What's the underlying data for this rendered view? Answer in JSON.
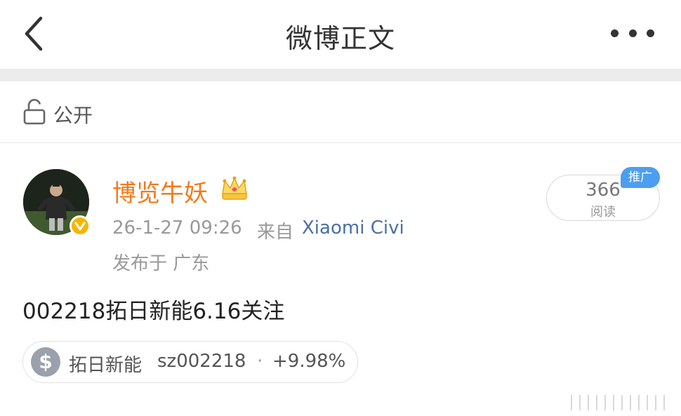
{
  "nav": {
    "title": "微博正文",
    "back_icon": "chevron-left-icon",
    "more_icon": "more-dots-icon"
  },
  "visibility": {
    "icon": "unlock-icon",
    "label": "公开"
  },
  "post": {
    "author": "博览牛妖",
    "author_color": "#f27a1d",
    "vip_icon": "crown-icon",
    "verified_icon": "verified-badge-icon",
    "time": "26-1-27 09:26",
    "source_prefix": "来自",
    "source_device": "Xiaomi Civi",
    "location": "发布于 广东",
    "views": {
      "count": "366",
      "label": "阅读",
      "promo_badge": "推广"
    },
    "text": "002218拓日新能6.16关注",
    "stock": {
      "icon": "dollar-icon",
      "name": "拓日新能",
      "code": "sz002218",
      "separator": "·",
      "change": "+9.98%"
    }
  },
  "colors": {
    "accent_orange": "#f27a1d",
    "link_blue": "#4a6fa5",
    "promo_blue": "#4d9ef0"
  }
}
